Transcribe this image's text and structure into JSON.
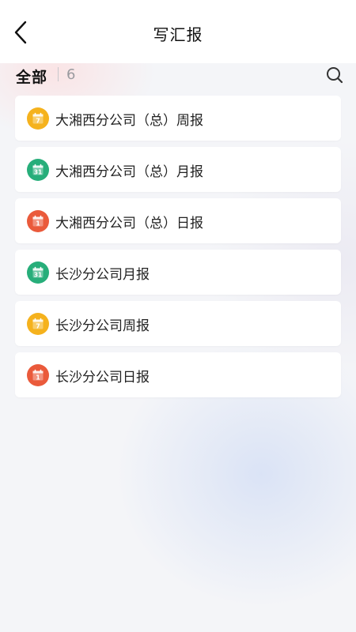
{
  "header": {
    "title": "写汇报",
    "back_icon": "back-arrow-icon"
  },
  "filter": {
    "label": "全部",
    "count": "6",
    "search_icon": "search-icon"
  },
  "icon_colors": {
    "weekly": "#f5b21d",
    "monthly": "#27ae7a",
    "daily": "#ea5a3b"
  },
  "reports": [
    {
      "label": "大湘西分公司（总）周报",
      "type": "weekly",
      "icon_number": "7"
    },
    {
      "label": "大湘西分公司（总）月报",
      "type": "monthly",
      "icon_number": "31"
    },
    {
      "label": "大湘西分公司（总）日报",
      "type": "daily",
      "icon_number": "1"
    },
    {
      "label": "长沙分公司月报",
      "type": "monthly",
      "icon_number": "31"
    },
    {
      "label": "长沙分公司周报",
      "type": "weekly",
      "icon_number": "7"
    },
    {
      "label": "长沙分公司日报",
      "type": "daily",
      "icon_number": "1"
    }
  ]
}
